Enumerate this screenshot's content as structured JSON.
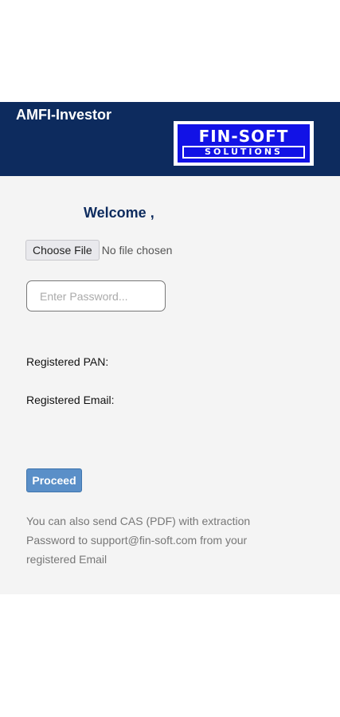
{
  "header": {
    "title": "AMFI-Investor",
    "logo": {
      "line1": "FIN-SOFT",
      "line2": "SOLUTIONS"
    }
  },
  "main": {
    "welcome": "Welcome ,",
    "file_button_label": "Choose File",
    "file_status": "No file chosen",
    "password_placeholder": "Enter Password...",
    "password_value": "",
    "pan_label": "Registered PAN:",
    "email_label": "Registered Email:",
    "proceed_label": "Proceed",
    "info_text": "You can also send CAS (PDF) with extraction Password to support@fin-soft.com from your registered Email"
  },
  "colors": {
    "header_bg": "#0d2b5e",
    "logo_blue": "#1212e6",
    "content_bg": "#f4f4f4",
    "proceed_bg": "#5a8fc8"
  }
}
